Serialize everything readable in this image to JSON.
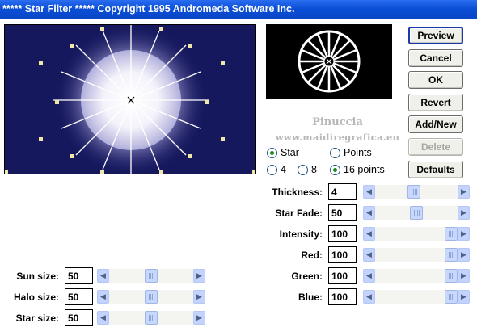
{
  "window": {
    "title": "***** Star Filter *****  Copyright 1995 Andromeda Software Inc."
  },
  "buttons": {
    "preview": "Preview",
    "cancel": "Cancel",
    "ok": "OK",
    "revert": "Revert",
    "add_new": "Add/New",
    "delete": "Delete",
    "defaults": "Defaults"
  },
  "watermark": {
    "line1": "Pinuccia",
    "line2": "www.maidiregrafica.eu"
  },
  "shape_options": {
    "star": {
      "label": "Star",
      "selected": true
    },
    "points": {
      "label": "Points",
      "selected": false
    }
  },
  "point_options": {
    "four": {
      "label": "4",
      "selected": false
    },
    "eight": {
      "label": "8",
      "selected": false
    },
    "sixteen": {
      "label": "16 points",
      "selected": true
    }
  },
  "right_controls": [
    {
      "label": "Thickness:",
      "value": "4",
      "fraction": 0.47
    },
    {
      "label": "Star Fade:",
      "value": "50",
      "fraction": 0.5
    },
    {
      "label": "Intensity:",
      "value": "100",
      "fraction": 1.0
    },
    {
      "label": "Red:",
      "value": "100",
      "fraction": 1.0
    },
    {
      "label": "Green:",
      "value": "100",
      "fraction": 1.0
    },
    {
      "label": "Blue:",
      "value": "100",
      "fraction": 1.0
    }
  ],
  "left_controls": [
    {
      "label": "Sun size:",
      "value": "50",
      "fraction": 0.5
    },
    {
      "label": "Halo size:",
      "value": "50",
      "fraction": 0.5
    },
    {
      "label": "Star size:",
      "value": "50",
      "fraction": 0.5
    }
  ],
  "colors": {
    "preview_background": "#16185e",
    "title_bar": "#0b4fd6",
    "scroll_arrow": "#c3d3fd"
  }
}
